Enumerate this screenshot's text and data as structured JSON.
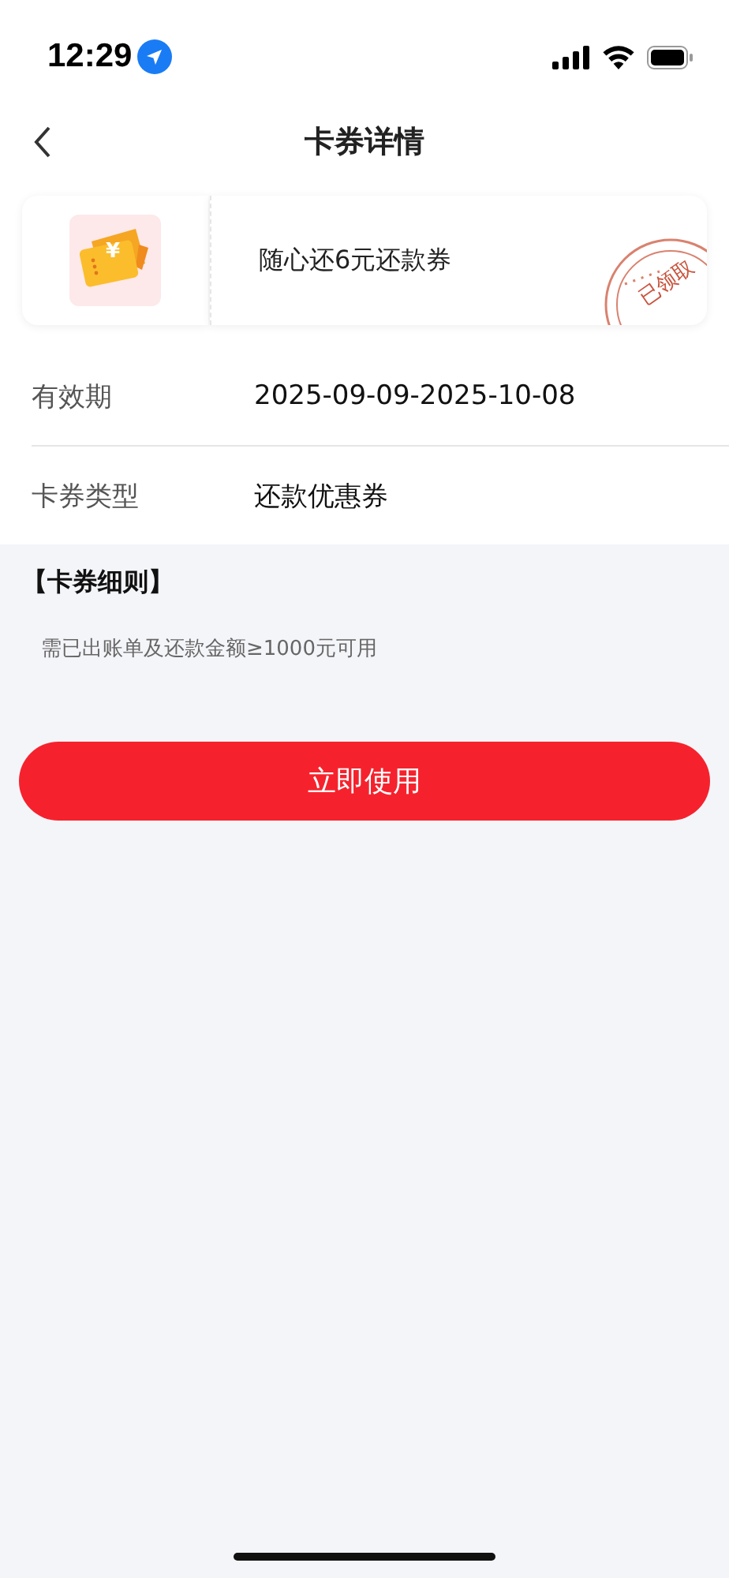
{
  "status_bar": {
    "time": "12:29"
  },
  "nav": {
    "title": "卡券详情"
  },
  "coupon": {
    "name": "随心还6元还款券",
    "stamp": "已领取",
    "icon_symbol": "¥"
  },
  "details": [
    {
      "label": "有效期",
      "value": "2025-09-09-2025-10-08"
    },
    {
      "label": "卡券类型",
      "value": "还款优惠券"
    }
  ],
  "rules": {
    "title": "【卡券细则】",
    "text": "需已出账单及还款金额≥1000元可用"
  },
  "button": {
    "label": "立即使用"
  }
}
